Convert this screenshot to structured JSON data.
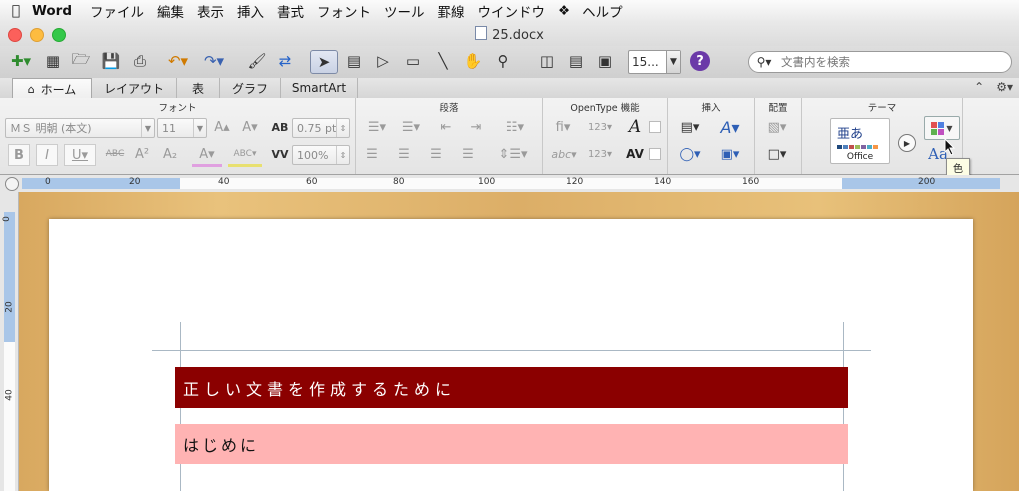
{
  "menubar": {
    "app": "Word",
    "items": [
      "ファイル",
      "編集",
      "表示",
      "挿入",
      "書式",
      "フォント",
      "ツール",
      "罫線",
      "ウインドウ",
      "ヘルプ"
    ]
  },
  "window": {
    "title": "25.docx"
  },
  "toolbar": {
    "zoom": "15...",
    "help": "?",
    "search_placeholder": "文書内を検索"
  },
  "ribbon_tabs": {
    "home": "ホーム",
    "layout": "レイアウト",
    "table": "表",
    "graph": "グラフ",
    "smartart": "SmartArt"
  },
  "ribbon": {
    "groups": {
      "font": "フォント",
      "paragraph": "段落",
      "opentype": "OpenType 機能",
      "insert": "挿入",
      "arrange": "配置",
      "theme": "テーマ"
    },
    "font_name": "ＭＳ 明朝 (本文)",
    "font_size": "11",
    "spacing": "0.75 pt",
    "scale": "100%",
    "theme_sample": "亜あ",
    "theme_name": "Office",
    "tooltip": "色",
    "theme_font_label": "Aa"
  },
  "ruler": {
    "labels": [
      "0",
      "20",
      "40",
      "60",
      "80",
      "100",
      "120",
      "140",
      "160",
      "200"
    ],
    "vlabels": [
      "0",
      "20",
      "40"
    ]
  },
  "document": {
    "heading1": "正しい文書を作成するために",
    "heading2": "はじめに"
  },
  "colors": {
    "heading1_bg": "#8b0000",
    "heading2_bg": "#ffb3b3",
    "help_icon": "#6b3aa8",
    "desk": "#e0b46c"
  }
}
